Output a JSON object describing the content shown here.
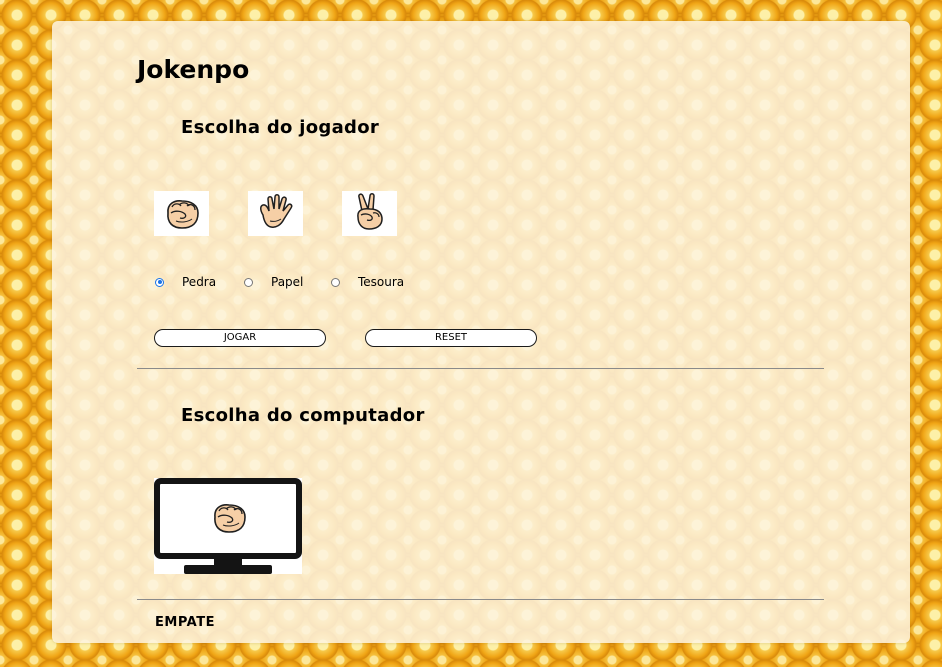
{
  "app": {
    "title": "Jokenpo"
  },
  "player": {
    "section_title": "Escolha do jogador",
    "hands": [
      {
        "icon": "rock-hand-icon"
      },
      {
        "icon": "paper-hand-icon"
      },
      {
        "icon": "scissors-hand-icon"
      }
    ],
    "options": [
      {
        "label": "Pedra",
        "selected": true
      },
      {
        "label": "Papel",
        "selected": false
      },
      {
        "label": "Tesoura",
        "selected": false
      }
    ]
  },
  "buttons": {
    "play_label": "JOGAR",
    "reset_label": "RESET"
  },
  "computer": {
    "section_title": "Escolha do computador",
    "choice_icon": "rock-hand-icon",
    "display_icon": "monitor-icon"
  },
  "result": {
    "text": "EMPATE"
  },
  "colors": {
    "background": "#f1a816",
    "panel": "#fdf3e0",
    "skin": "#f6cfa6",
    "outline": "#1f1f1f",
    "radio_accent": "#1a73e8"
  }
}
